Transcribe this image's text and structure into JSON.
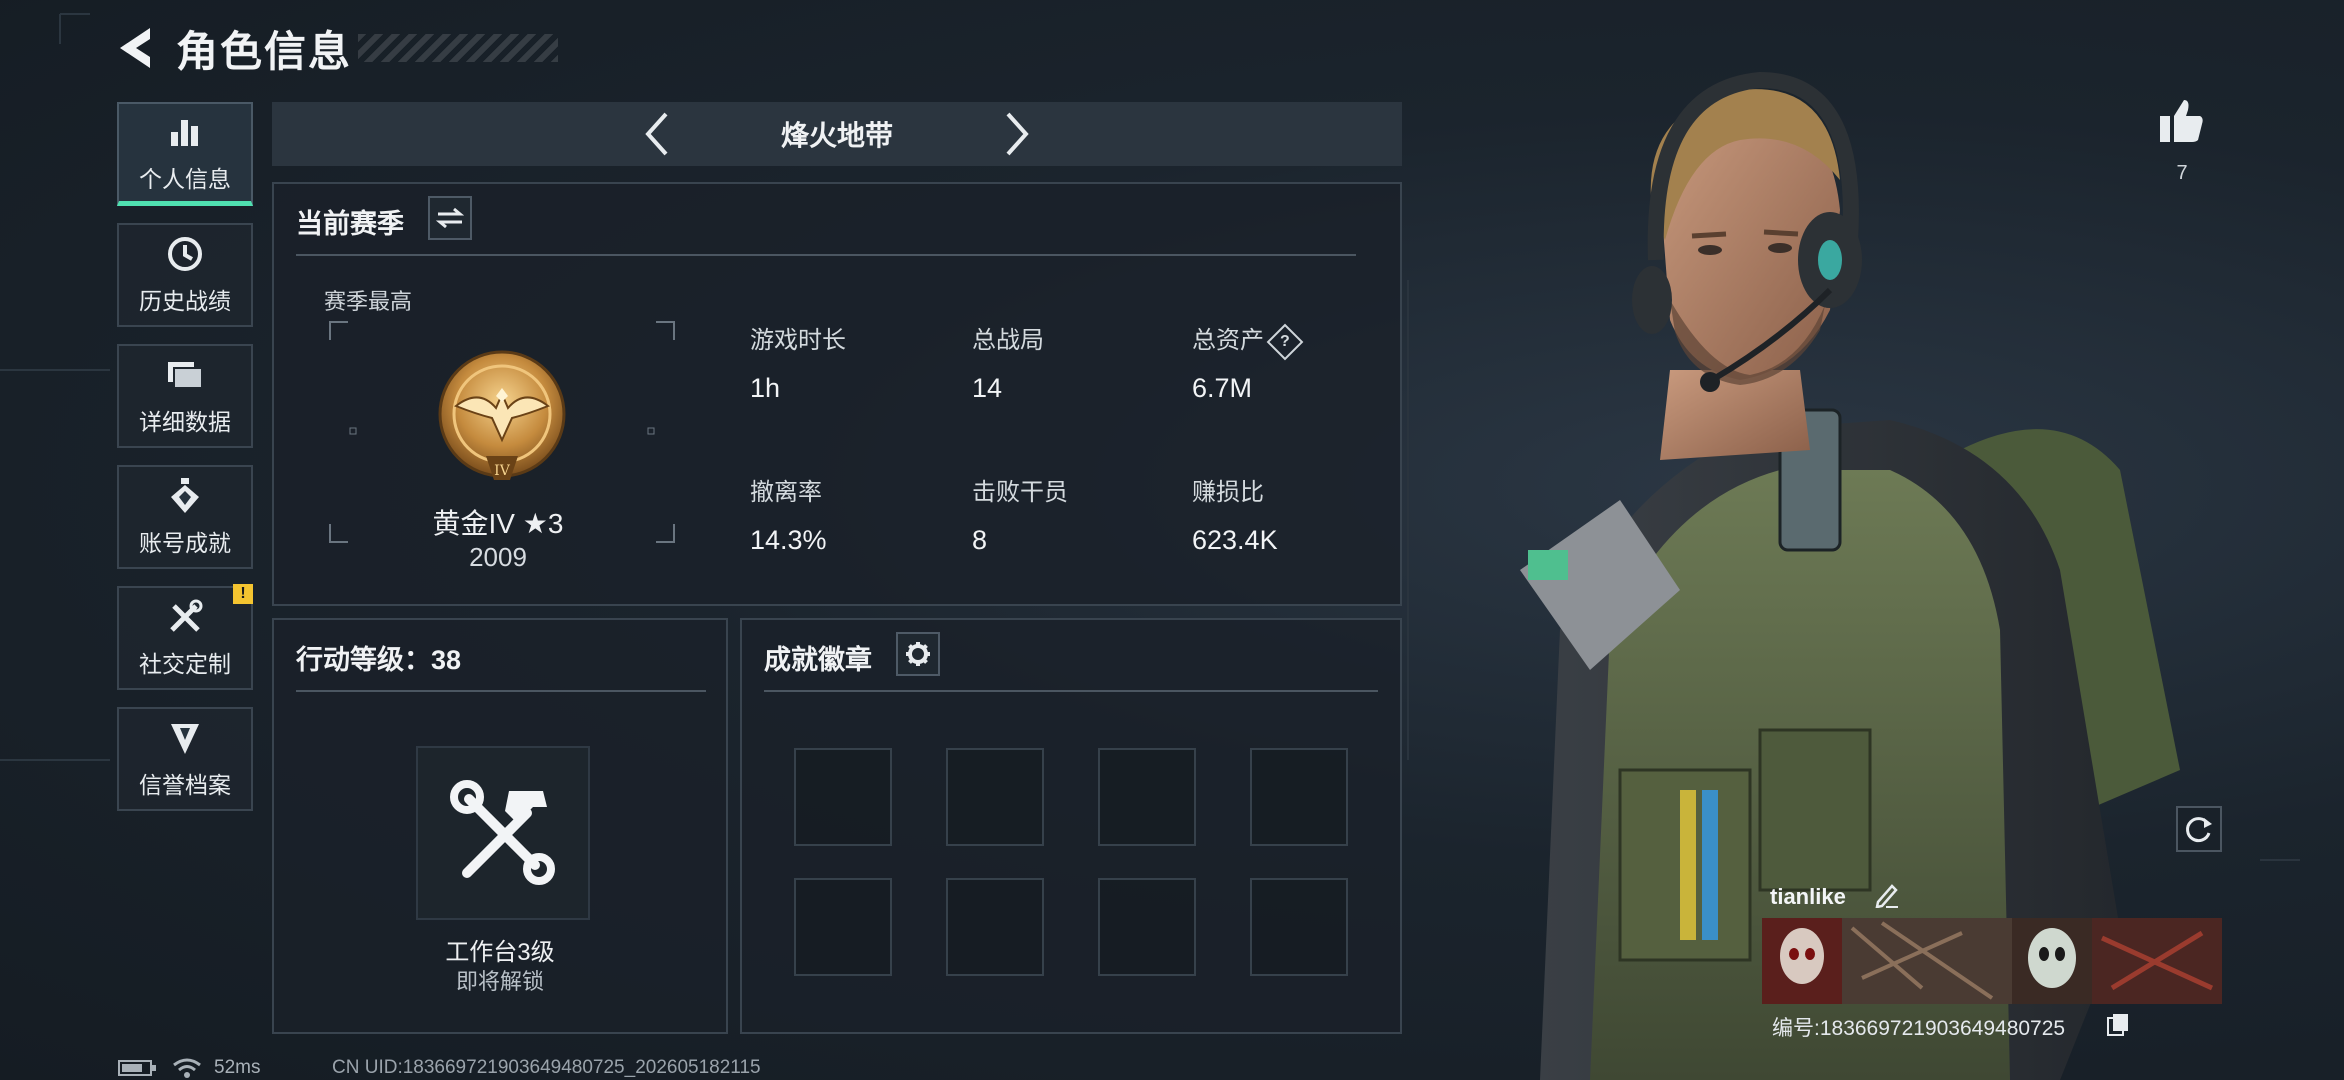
{
  "header": {
    "title": "角色信息",
    "back_icon": "back-arrow-icon"
  },
  "sidebar": {
    "items": [
      {
        "label": "个人信息",
        "icon": "bar-chart-icon",
        "active": true
      },
      {
        "label": "历史战绩",
        "icon": "clock-icon",
        "active": false
      },
      {
        "label": "详细数据",
        "icon": "folder-icon",
        "active": false
      },
      {
        "label": "账号成就",
        "icon": "medal-icon",
        "active": false
      },
      {
        "label": "社交定制",
        "icon": "tools-icon",
        "active": false,
        "badge": "!"
      },
      {
        "label": "信誉档案",
        "icon": "shield-emblem-icon",
        "active": false
      }
    ]
  },
  "mode": {
    "title": "烽火地带"
  },
  "season": {
    "title": "当前赛季",
    "best_label": "赛季最高",
    "rank_name": "黄金IV ★3",
    "rank_score": "2009",
    "stats": [
      {
        "label": "游戏时长",
        "value": "1h"
      },
      {
        "label": "总战局",
        "value": "14"
      },
      {
        "label": "总资产",
        "value": "6.7M",
        "help": "?"
      },
      {
        "label": "撤离率",
        "value": "14.3%"
      },
      {
        "label": "击败干员",
        "value": "8"
      },
      {
        "label": "赚损比",
        "value": "623.4K"
      }
    ]
  },
  "action": {
    "title": "行动等级：38",
    "workbench_name": "工作台3级",
    "workbench_status": "即将解锁"
  },
  "achievements": {
    "title": "成就徽章",
    "slots": 8
  },
  "profile": {
    "likes": "7",
    "name": "tianlike",
    "id_text": "编号:1836697219036494807​25"
  },
  "statusbar": {
    "ping": "52ms",
    "uid": "CN UID:183669721903649480725_202605182115"
  },
  "colors": {
    "accent": "#4fe0b0",
    "badge": "#f4c430",
    "panel_border": "#39444f"
  }
}
